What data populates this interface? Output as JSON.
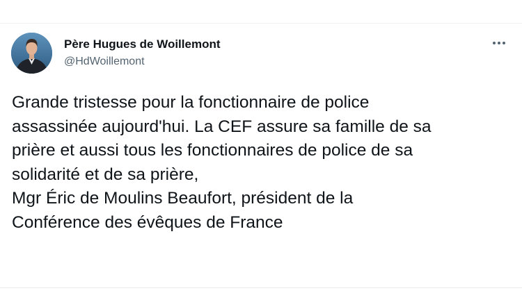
{
  "tweet": {
    "author": {
      "display_name": "Père Hugues de Woillemont",
      "handle": "@HdWoillemont",
      "avatar_icon": "profile-photo"
    },
    "menu_icon": "more-options-icon",
    "text_lines": [
      "Grande tristesse pour la fonctionnaire de police",
      "assassinée aujourd'hui. La CEF assure sa famille de sa",
      "prière et aussi tous les fonctionnaires de police de sa",
      "solidarité et de sa prière,",
      "Mgr Éric de Moulins Beaufort, président de la",
      "Conférence des évêques de France"
    ]
  },
  "colors": {
    "text_primary": "#0f1419",
    "text_secondary": "#536471",
    "divider": "#eef0f2"
  }
}
